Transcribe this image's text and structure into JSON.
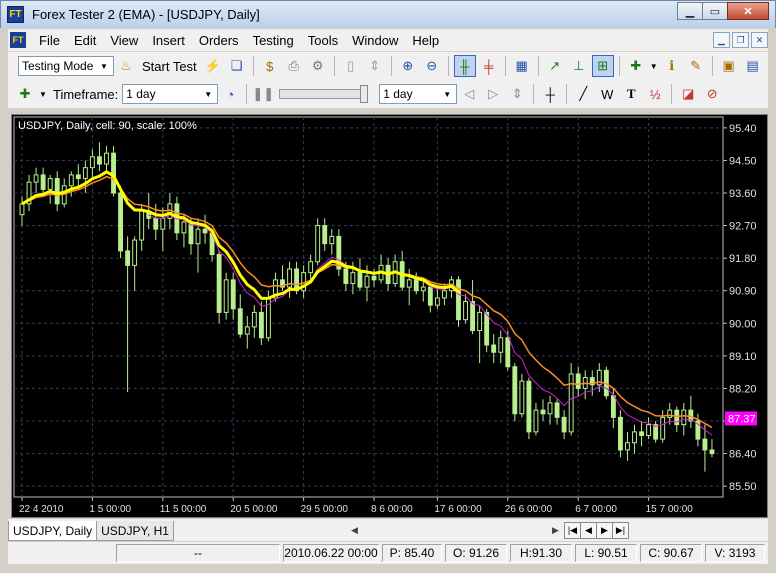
{
  "window": {
    "title": "Forex Tester 2  (EMA) - [USDJPY, Daily]",
    "app_icon": "FT"
  },
  "menu": [
    "File",
    "Edit",
    "View",
    "Insert",
    "Orders",
    "Testing",
    "Tools",
    "Window",
    "Help"
  ],
  "toolbar1": {
    "mode_value": "Testing Mode",
    "start_test_label": "Start Test"
  },
  "toolbar2": {
    "timeframe_label": "Timeframe:",
    "timeframe_value": "1 day",
    "step_value": "1 day"
  },
  "chart_data": {
    "type": "candlestick",
    "header": "USDJPY, Daily, cell: 90, scale: 100%",
    "price_ticks": [
      "95.40",
      "94.50",
      "93.60",
      "92.70",
      "91.80",
      "90.90",
      "90.00",
      "89.10",
      "88.20",
      "87.30",
      "86.40",
      "85.50"
    ],
    "time_ticks": [
      "22 4 2010",
      "1 5 00:00",
      "11 5 00:00",
      "20 5 00:00",
      "29 5 00:00",
      "8 6 00:00",
      "17 6 00:00",
      "26 6 00:00",
      "6 7 00:00",
      "15 7 00:00"
    ],
    "current_price_label": "87.37",
    "current_price": 87.37,
    "ylim": [
      85.2,
      95.7
    ],
    "candle_color": "#b9ef8f",
    "ema_fast_color": "#ffff00",
    "ema_slow_color": "#ff8a2a",
    "ema_alt_color": "#d020d0",
    "candles": [
      [
        93.0,
        93.5,
        92.7,
        93.3
      ],
      [
        93.3,
        94.1,
        93.1,
        93.9
      ],
      [
        93.9,
        94.3,
        93.6,
        94.1
      ],
      [
        94.1,
        94.3,
        93.5,
        93.7
      ],
      [
        93.7,
        94.1,
        93.3,
        94.0
      ],
      [
        94.0,
        94.2,
        93.1,
        93.3
      ],
      [
        93.3,
        94.0,
        93.2,
        93.8
      ],
      [
        93.8,
        94.2,
        93.5,
        94.1
      ],
      [
        94.1,
        94.4,
        93.7,
        94.0
      ],
      [
        94.0,
        94.5,
        93.6,
        94.3
      ],
      [
        94.3,
        94.8,
        94.0,
        94.6
      ],
      [
        94.6,
        95.0,
        94.2,
        94.4
      ],
      [
        94.4,
        94.9,
        94.2,
        94.7
      ],
      [
        94.7,
        94.9,
        93.5,
        93.6
      ],
      [
        93.6,
        93.8,
        91.8,
        92.0
      ],
      [
        92.0,
        92.4,
        88.1,
        91.6
      ],
      [
        91.6,
        92.4,
        90.9,
        92.3
      ],
      [
        92.3,
        93.3,
        92.0,
        93.1
      ],
      [
        93.1,
        93.6,
        92.6,
        92.9
      ],
      [
        92.9,
        93.3,
        92.3,
        92.6
      ],
      [
        92.6,
        93.2,
        92.0,
        92.9
      ],
      [
        92.9,
        93.6,
        92.6,
        93.3
      ],
      [
        93.3,
        93.5,
        92.3,
        92.5
      ],
      [
        92.5,
        93.0,
        92.1,
        92.8
      ],
      [
        92.8,
        92.9,
        91.9,
        92.2
      ],
      [
        92.2,
        92.9,
        91.4,
        92.6
      ],
      [
        92.6,
        93.0,
        92.2,
        92.5
      ],
      [
        92.5,
        92.6,
        91.7,
        91.9
      ],
      [
        91.9,
        92.0,
        90.0,
        90.3
      ],
      [
        90.3,
        91.4,
        90.1,
        91.2
      ],
      [
        91.2,
        91.4,
        90.1,
        90.4
      ],
      [
        90.4,
        90.8,
        89.6,
        89.7
      ],
      [
        89.7,
        90.2,
        89.3,
        89.9
      ],
      [
        89.9,
        90.5,
        89.6,
        90.3
      ],
      [
        90.3,
        90.6,
        89.4,
        89.6
      ],
      [
        89.6,
        90.9,
        89.5,
        90.7
      ],
      [
        90.7,
        91.4,
        90.6,
        91.2
      ],
      [
        91.2,
        91.6,
        90.9,
        91.0
      ],
      [
        91.0,
        91.7,
        90.7,
        91.5
      ],
      [
        91.5,
        91.7,
        90.8,
        90.9
      ],
      [
        90.9,
        91.6,
        90.7,
        91.4
      ],
      [
        91.4,
        91.9,
        91.2,
        91.7
      ],
      [
        91.7,
        92.9,
        91.6,
        92.7
      ],
      [
        92.7,
        92.9,
        92.0,
        92.2
      ],
      [
        92.2,
        92.6,
        91.9,
        92.4
      ],
      [
        92.4,
        92.6,
        91.3,
        91.5
      ],
      [
        91.5,
        91.7,
        90.9,
        91.1
      ],
      [
        91.1,
        91.7,
        90.8,
        91.4
      ],
      [
        91.4,
        91.8,
        90.9,
        91.0
      ],
      [
        91.0,
        91.6,
        90.6,
        91.3
      ],
      [
        91.3,
        91.5,
        91.0,
        91.2
      ],
      [
        91.2,
        91.9,
        91.1,
        91.6
      ],
      [
        91.6,
        91.8,
        90.9,
        91.1
      ],
      [
        91.1,
        91.9,
        91.0,
        91.7
      ],
      [
        91.7,
        92.0,
        90.9,
        91.0
      ],
      [
        91.0,
        91.5,
        90.5,
        91.2
      ],
      [
        91.2,
        91.4,
        90.8,
        90.9
      ],
      [
        90.9,
        91.2,
        90.6,
        91.0
      ],
      [
        91.0,
        91.1,
        90.3,
        90.5
      ],
      [
        90.5,
        91.0,
        90.4,
        90.7
      ],
      [
        90.7,
        91.1,
        90.5,
        90.9
      ],
      [
        90.9,
        91.3,
        90.7,
        91.2
      ],
      [
        91.2,
        91.3,
        89.9,
        90.1
      ],
      [
        90.1,
        90.8,
        90.0,
        90.6
      ],
      [
        90.6,
        91.2,
        89.7,
        89.8
      ],
      [
        89.8,
        90.5,
        88.9,
        90.3
      ],
      [
        90.3,
        90.4,
        89.2,
        89.4
      ],
      [
        89.4,
        89.7,
        88.9,
        89.2
      ],
      [
        89.2,
        89.8,
        88.9,
        89.6
      ],
      [
        89.6,
        89.8,
        88.7,
        88.8
      ],
      [
        88.8,
        88.9,
        87.3,
        87.5
      ],
      [
        87.5,
        88.6,
        87.4,
        88.4
      ],
      [
        88.4,
        88.5,
        86.8,
        87.0
      ],
      [
        87.0,
        87.8,
        86.9,
        87.6
      ],
      [
        87.6,
        87.9,
        87.3,
        87.5
      ],
      [
        87.5,
        88.0,
        87.2,
        87.8
      ],
      [
        87.8,
        87.9,
        87.2,
        87.4
      ],
      [
        87.4,
        87.6,
        86.8,
        87.0
      ],
      [
        87.0,
        88.9,
        86.9,
        88.6
      ],
      [
        88.6,
        88.8,
        88.0,
        88.2
      ],
      [
        88.2,
        88.7,
        87.9,
        88.5
      ],
      [
        88.5,
        88.7,
        88.0,
        88.3
      ],
      [
        88.3,
        88.9,
        88.1,
        88.7
      ],
      [
        88.7,
        88.8,
        87.9,
        88.0
      ],
      [
        88.0,
        88.2,
        87.1,
        87.4
      ],
      [
        87.4,
        87.6,
        86.3,
        86.5
      ],
      [
        86.5,
        87.0,
        86.2,
        86.7
      ],
      [
        86.7,
        87.2,
        86.4,
        87.0
      ],
      [
        87.0,
        87.3,
        86.6,
        86.9
      ],
      [
        86.9,
        87.4,
        86.8,
        87.2
      ],
      [
        87.2,
        87.3,
        86.7,
        86.8
      ],
      [
        86.8,
        87.6,
        86.7,
        87.4
      ],
      [
        87.4,
        87.8,
        87.2,
        87.6
      ],
      [
        87.6,
        87.7,
        87.0,
        87.2
      ],
      [
        87.2,
        87.8,
        86.9,
        87.6
      ],
      [
        87.6,
        88.0,
        87.1,
        87.3
      ],
      [
        87.3,
        87.5,
        86.6,
        86.8
      ],
      [
        86.8,
        87.2,
        85.9,
        86.5
      ],
      [
        86.5,
        86.8,
        86.3,
        86.4
      ]
    ]
  },
  "tabs": [
    "USDJPY, Daily",
    "USDJPY, H1"
  ],
  "status": {
    "blank": "--",
    "datetime": "2010.06.22 00:00",
    "price": "P: 85.40",
    "open": "O: 91.26",
    "high": "H:91.30",
    "low": "L: 90.51",
    "close": "C: 90.67",
    "volume": "V: 3193"
  }
}
